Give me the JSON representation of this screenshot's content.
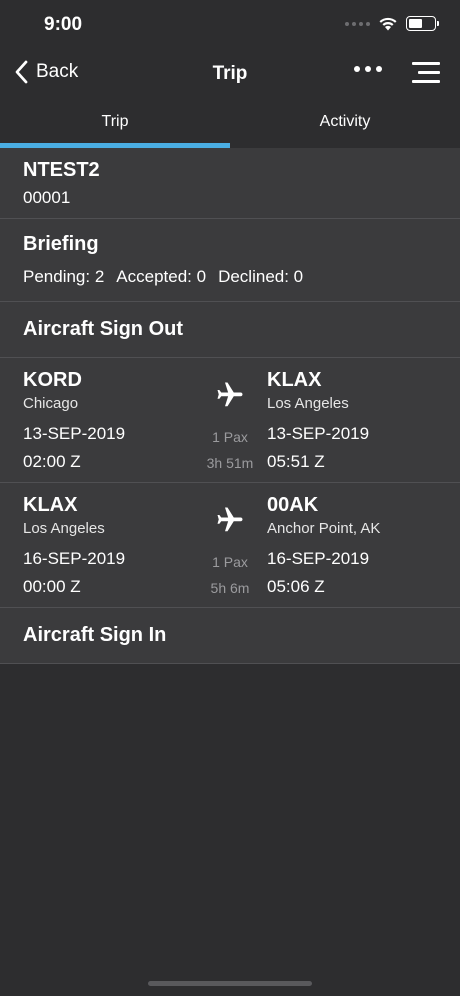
{
  "status_bar": {
    "time": "9:00"
  },
  "nav": {
    "back_label": "Back",
    "title": "Trip"
  },
  "tabs": [
    {
      "label": "Trip",
      "active": true
    },
    {
      "label": "Activity",
      "active": false
    }
  ],
  "trip": {
    "name": "NTEST2",
    "number": "00001"
  },
  "briefing": {
    "title": "Briefing",
    "pending": "Pending: 2",
    "accepted": "Accepted: 0",
    "declined": "Declined: 0"
  },
  "sign_out": {
    "title": "Aircraft Sign Out"
  },
  "legs": [
    {
      "from_code": "KORD",
      "from_city": "Chicago",
      "from_date": "13-SEP-2019",
      "from_time": "02:00 Z",
      "to_code": "KLAX",
      "to_city": "Los Angeles",
      "to_date": "13-SEP-2019",
      "to_time": "05:51 Z",
      "pax": "1 Pax",
      "duration": "3h 51m",
      "icon": "airplane-icon"
    },
    {
      "from_code": "KLAX",
      "from_city": "Los Angeles",
      "from_date": "16-SEP-2019",
      "from_time": "00:00 Z",
      "to_code": "00AK",
      "to_city": "Anchor Point, AK",
      "to_date": "16-SEP-2019",
      "to_time": "05:06 Z",
      "pax": "1 Pax",
      "duration": "5h 6m",
      "icon": "airplane-icon"
    }
  ],
  "sign_in": {
    "title": "Aircraft Sign In"
  },
  "colors": {
    "background": "#2d2d2f",
    "card": "#3b3b3d",
    "accent": "#4aaee3",
    "secondary_text": "#9b9b9e"
  }
}
